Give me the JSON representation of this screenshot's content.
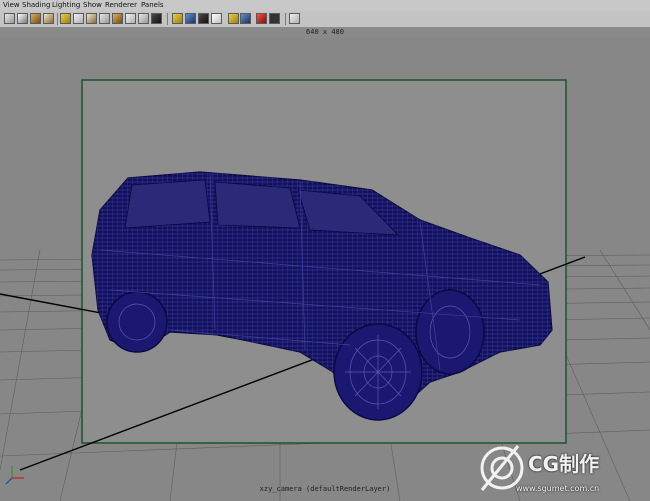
{
  "menubar": {
    "items": [
      "View",
      "Shading",
      "Lighting",
      "Show",
      "Renderer",
      "Panels"
    ]
  },
  "toolbar": {
    "icons": [
      "select-camera-icon",
      "camera-attributes-icon",
      "bookmark-icon",
      "image-plane-icon",
      "resolution-gate-icon",
      "grid-icon",
      "film-gate-icon",
      "field-chart-icon",
      "safe-action-icon",
      "safe-title-icon",
      "isolate-select-icon",
      "xray-icon",
      "wireframe-icon",
      "smooth-shade-icon",
      "textured-icon",
      "use-all-lights-icon",
      "shadows-icon",
      "high-quality-icon",
      "wireframe-on-shaded-icon",
      "backface-culling-icon",
      "motion-blur-icon"
    ]
  },
  "viewport": {
    "resolution_label": "640 x 480",
    "camera_label": "xzy_camera (defaultRenderLayer)",
    "background_color": "#8c8c8c",
    "gate_color": "#1e5a32",
    "wireframe_color": "#121060"
  },
  "watermark": {
    "title": "CG制作",
    "url": "www.sgumet.com.cn"
  }
}
